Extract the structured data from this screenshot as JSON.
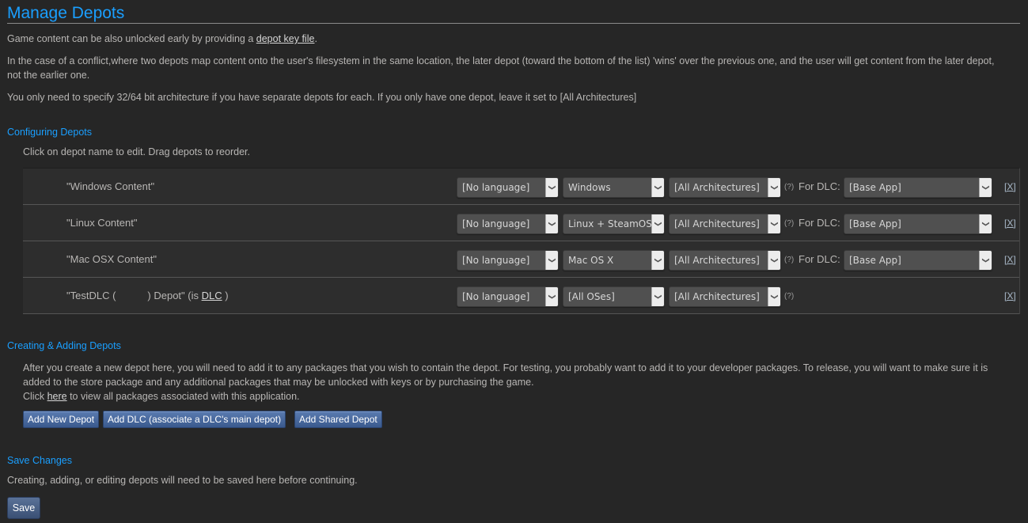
{
  "page": {
    "title": "Manage Depots",
    "intro": {
      "line1_prefix": "Game content can be also unlocked early by providing a ",
      "line1_link": "depot key file",
      "line1_suffix": ".",
      "conflict_text": "In the case of a conflict,where two depots map content onto the user's filesystem in the same location, the later depot (toward the bottom of the list) 'wins' over the previous one, and the user will get content from the later depot, not the earlier one.",
      "arch_text": "You only need to specify 32/64 bit architecture if you have separate depots for each. If you only have one depot, leave it set to [All Architectures]"
    }
  },
  "configuring": {
    "heading": "Configuring Depots",
    "hint": "Click on depot name to edit. Drag depots to reorder.",
    "qmark": "(?)",
    "for_dlc_label": "For DLC:",
    "remove_label": "[X]",
    "depots": [
      {
        "name": "\"Windows Content\"",
        "language": "[No language]",
        "os": "Windows",
        "arch": "[All Architectures]",
        "dlc": "[Base App]"
      },
      {
        "name": "\"Linux Content\"",
        "language": "[No language]",
        "os": "Linux + SteamOS",
        "arch": "[All Architectures]",
        "dlc": "[Base App]"
      },
      {
        "name": "\"Mac OSX Content\"",
        "language": "[No language]",
        "os": "Mac OS X",
        "arch": "[All Architectures]",
        "dlc": "[Base App]"
      },
      {
        "name_prefix": "\"TestDLC (",
        "name_suffix": ") Depot\" (is ",
        "dlc_link": "DLC",
        "name_end": " )",
        "language": "[No language]",
        "os": "[All OSes]",
        "arch": "[All Architectures]"
      }
    ]
  },
  "creating": {
    "heading": "Creating & Adding Depots",
    "text": "After you create a new depot here, you will need to add it to any packages that you wish to contain the depot. For testing, you probably want to add it to your developer packages. To release, you will want to make sure it is added to the store package and any additional packages that may be unlocked with keys or by purchasing the game.",
    "click_prefix": "Click ",
    "click_link": "here",
    "click_suffix": " to view all packages associated with this application.",
    "buttons": {
      "add_new": "Add New Depot",
      "add_dlc": "Add DLC (associate a DLC's main depot)",
      "add_shared": "Add Shared Depot"
    }
  },
  "save": {
    "heading": "Save Changes",
    "text": "Creating, adding, or editing depots will need to be saved here before continuing.",
    "button": "Save"
  },
  "icons": {
    "dropdown_arrow": "chevron-down"
  }
}
